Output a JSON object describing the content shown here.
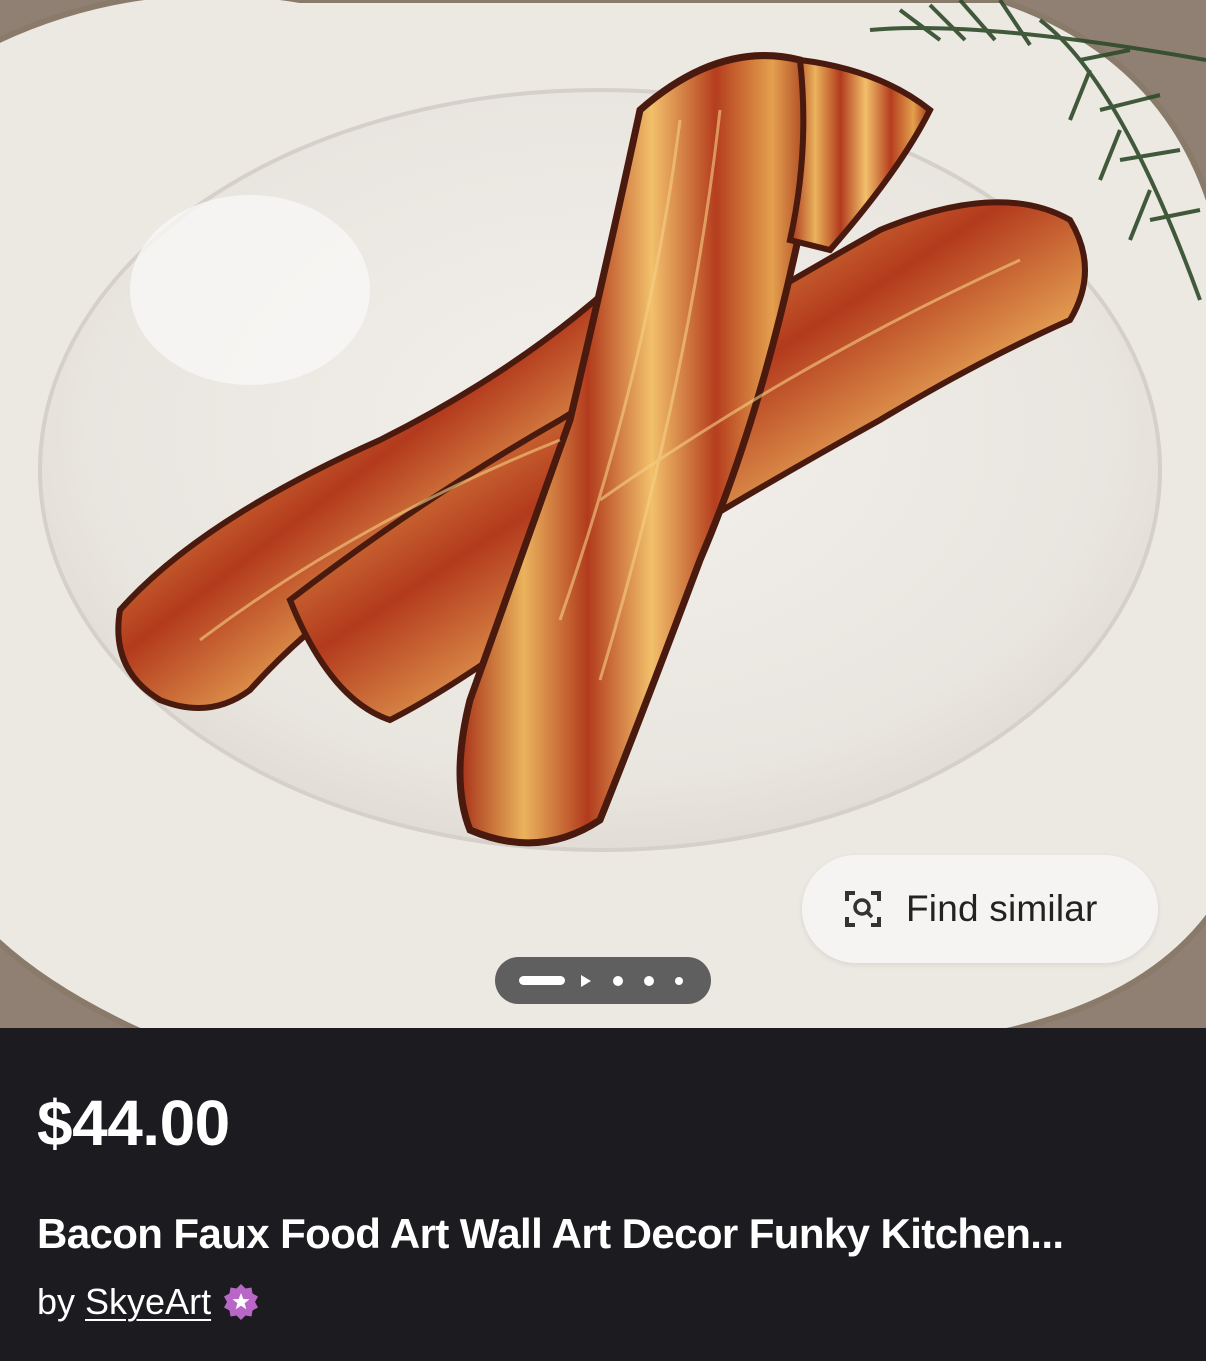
{
  "listing": {
    "price": "$44.00",
    "title": "Bacon Faux Food Art Wall Art Decor Funky Kitchen...",
    "by_label": "by",
    "shop_name": "SkyeArt"
  },
  "image_actions": {
    "find_similar_label": "Find similar"
  },
  "colors": {
    "info_background": "#1c1b1f",
    "badge": "#b967c7",
    "pill_background": "#f6f4f3"
  }
}
